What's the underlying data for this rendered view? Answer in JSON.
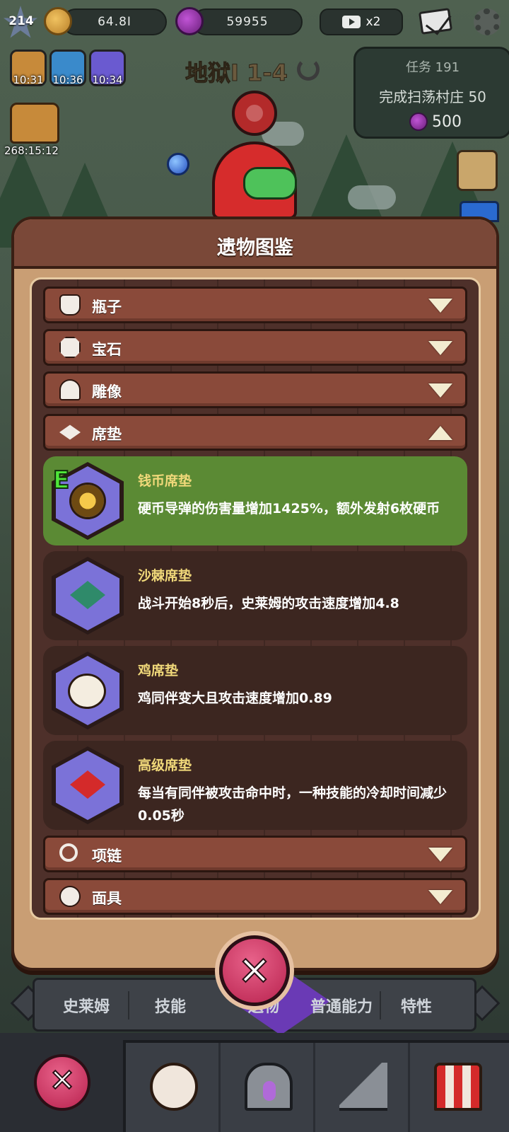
{
  "top_bar": {
    "level": "214",
    "gold": "64.8I",
    "gems": "59955",
    "video_multiplier": "x2"
  },
  "boosts": [
    {
      "icon": "gold-stack-icon",
      "time": "10:31"
    },
    {
      "icon": "sword-icon",
      "time": "10:36"
    },
    {
      "icon": "lightning-icon",
      "time": "10:34"
    }
  ],
  "idle_bag": {
    "time": "268:15:12"
  },
  "stage": {
    "title": "地狱I 1-4"
  },
  "quest": {
    "title": "任务 191",
    "description": "完成扫荡村庄 50",
    "reward": "500"
  },
  "dialog": {
    "title": "遗物图鉴",
    "categories_top": [
      {
        "label": "瓶子",
        "icon": "vase-icon",
        "expanded": false
      },
      {
        "label": "宝石",
        "icon": "gem-icon",
        "expanded": false
      },
      {
        "label": "雕像",
        "icon": "statue-icon",
        "expanded": false
      },
      {
        "label": "席垫",
        "icon": "mat-icon",
        "expanded": true
      }
    ],
    "relics": [
      {
        "name": "钱币席垫",
        "desc": "硬币导弹的伤害量增加1425%，额外发射6枚硬币",
        "rarity": "E",
        "icon": "coin-mat-icon",
        "highlighted": true
      },
      {
        "name": "沙棘席垫",
        "desc": "战斗开始8秒后，史莱姆的攻击速度增加4.8",
        "rarity": "",
        "icon": "spike-mat-icon",
        "highlighted": false
      },
      {
        "name": "鸡席垫",
        "desc": "鸡同伴变大且攻击速度增加0.89",
        "rarity": "",
        "icon": "chicken-mat-icon",
        "highlighted": false
      },
      {
        "name": "高级席垫",
        "desc": "每当有同伴被攻击命中时，一种技能的冷却时间减少0.05秒",
        "rarity": "",
        "icon": "premium-mat-icon",
        "highlighted": false
      }
    ],
    "categories_bottom": [
      {
        "label": "项链",
        "icon": "necklace-icon",
        "expanded": false
      },
      {
        "label": "面具",
        "icon": "mask-icon",
        "expanded": false
      }
    ]
  },
  "tabs": [
    {
      "label": "史莱姆"
    },
    {
      "label": "技能"
    },
    {
      "label": "遗物"
    },
    {
      "label": "普通能力"
    },
    {
      "label": "特性"
    }
  ],
  "colors": {
    "dialog_bg": "#c99e74",
    "category_row": "#8a4a3a",
    "active_relic": "#5b8a34",
    "relic_name": "#f1d97a",
    "close_button": "#d43a66"
  }
}
